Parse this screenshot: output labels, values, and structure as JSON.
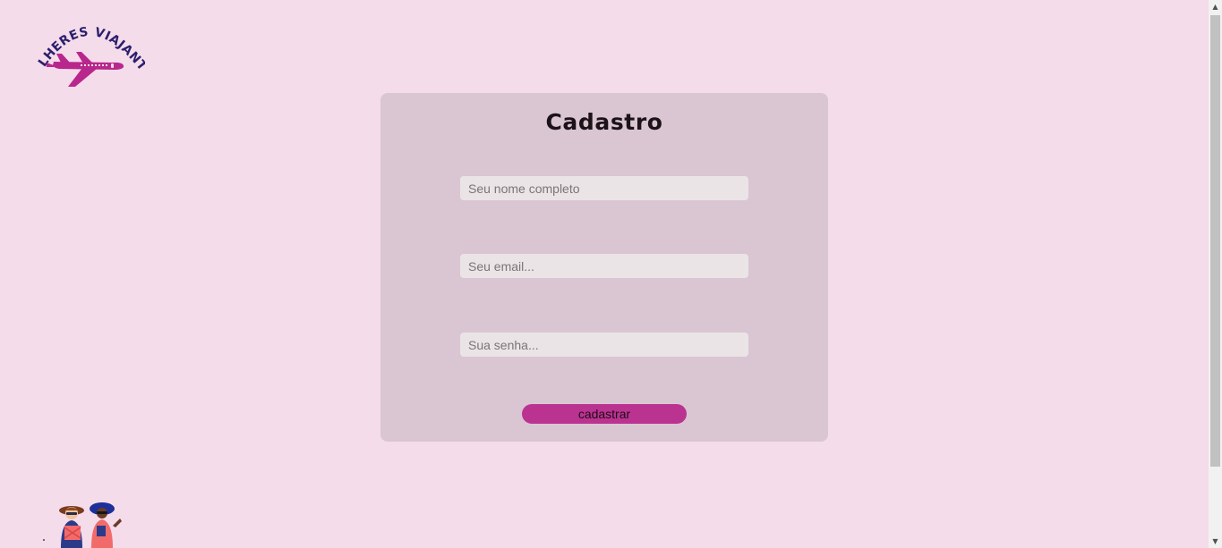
{
  "brand": {
    "logo_text": "MULHERES VIAJANTES"
  },
  "form": {
    "title": "Cadastro",
    "name_placeholder": "Seu nome completo",
    "email_placeholder": "Seu email...",
    "password_placeholder": "Sua senha...",
    "submit_label": "cadastrar"
  },
  "colors": {
    "background": "#f5dcea",
    "card": "#d9c6d2",
    "input": "#ebe4e6",
    "button": "#bb3391",
    "logo_text": "#2a1f6e",
    "plane": "#b8278c"
  },
  "icons": {
    "logo_plane": "airplane-icon",
    "travelers": "travelers-illustration",
    "scroll_up": "chevron-up-icon",
    "scroll_down": "chevron-down-icon"
  }
}
